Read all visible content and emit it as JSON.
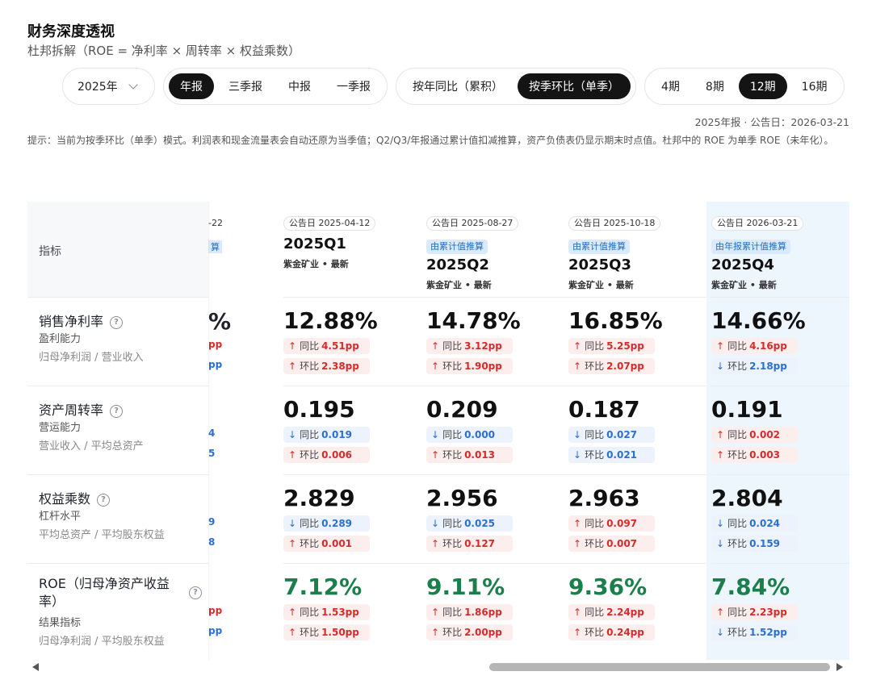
{
  "header": {
    "title": "财务深度透视",
    "subtitle": "杜邦拆解（ROE = 净利率 × 周转率 × 权益乘数）"
  },
  "toolbar": {
    "year": "2025年",
    "report_types": [
      "年报",
      "三季报",
      "中报",
      "一季报"
    ],
    "report_active": "年报",
    "compare_modes": [
      "按年同比（累积）",
      "按季环比（单季）"
    ],
    "compare_active": "按季环比（单季）",
    "periods": [
      "4期",
      "8期",
      "12期",
      "16期"
    ],
    "period_active": "12期"
  },
  "meta": "2025年报 · 公告日：2026-03-21",
  "tip": "提示：当前为按季环比（单季）模式。利润表和现金流量表会自动还原为当季值；Q2/Q3/年报通过累计值扣减推算，资产负债表仍显示期末时点值。杜邦中的 ROE 为单季 ROE（未年化）。",
  "table": {
    "indicator_header": "指标",
    "rows": [
      {
        "name": "销售净利率",
        "category": "盈利能力",
        "formula": "归母净利润 / 营业收入"
      },
      {
        "name": "资产周转率",
        "category": "营运能力",
        "formula": "营业收入 / 平均总资产"
      },
      {
        "name": "权益乘数",
        "category": "杠杆水平",
        "formula": "平均总资产 / 平均股东权益"
      },
      {
        "name": "ROE（归母净资产收益率）",
        "category": "结果指标",
        "formula": "归母净利润 / 平均股东权益"
      }
    ],
    "partial_column": {
      "announce": "-22",
      "est": "算",
      "values": [
        "%",
        "",
        "",
        ""
      ],
      "yoy": [
        "pp",
        "4",
        "9",
        "pp"
      ],
      "qoq": [
        "pp",
        "5",
        "8",
        "pp"
      ],
      "yoy_dir": [
        "up",
        "down",
        "down",
        "up"
      ],
      "qoq_dir": [
        "down",
        "down",
        "down",
        "down"
      ]
    },
    "columns": [
      {
        "announce": "公告日 2025-04-12",
        "estimate": "",
        "quarter": "2025Q1",
        "company": "紫金矿业 • 最新",
        "cells": [
          {
            "value": "12.88%",
            "yoy": "4.51pp",
            "yoy_dir": "up",
            "qoq": "2.38pp",
            "qoq_dir": "up"
          },
          {
            "value": "0.195",
            "yoy": "0.019",
            "yoy_dir": "down",
            "qoq": "0.006",
            "qoq_dir": "up"
          },
          {
            "value": "2.829",
            "yoy": "0.289",
            "yoy_dir": "down",
            "qoq": "0.001",
            "qoq_dir": "up"
          },
          {
            "value": "7.12%",
            "yoy": "1.53pp",
            "yoy_dir": "up",
            "qoq": "1.50pp",
            "qoq_dir": "up"
          }
        ]
      },
      {
        "announce": "公告日 2025-08-27",
        "estimate": "由累计值推算",
        "quarter": "2025Q2",
        "company": "紫金矿业 • 最新",
        "cells": [
          {
            "value": "14.78%",
            "yoy": "3.12pp",
            "yoy_dir": "up",
            "qoq": "1.90pp",
            "qoq_dir": "up"
          },
          {
            "value": "0.209",
            "yoy": "0.000",
            "yoy_dir": "down",
            "qoq": "0.013",
            "qoq_dir": "up"
          },
          {
            "value": "2.956",
            "yoy": "0.025",
            "yoy_dir": "down",
            "qoq": "0.127",
            "qoq_dir": "up"
          },
          {
            "value": "9.11%",
            "yoy": "1.86pp",
            "yoy_dir": "up",
            "qoq": "2.00pp",
            "qoq_dir": "up"
          }
        ]
      },
      {
        "announce": "公告日 2025-10-18",
        "estimate": "由累计值推算",
        "quarter": "2025Q3",
        "company": "紫金矿业 • 最新",
        "cells": [
          {
            "value": "16.85%",
            "yoy": "5.25pp",
            "yoy_dir": "up",
            "qoq": "2.07pp",
            "qoq_dir": "up"
          },
          {
            "value": "0.187",
            "yoy": "0.027",
            "yoy_dir": "down",
            "qoq": "0.021",
            "qoq_dir": "down"
          },
          {
            "value": "2.963",
            "yoy": "0.097",
            "yoy_dir": "up",
            "qoq": "0.007",
            "qoq_dir": "up"
          },
          {
            "value": "9.36%",
            "yoy": "2.24pp",
            "yoy_dir": "up",
            "qoq": "0.24pp",
            "qoq_dir": "up"
          }
        ]
      },
      {
        "announce": "公告日 2026-03-21",
        "estimate": "由年报累计值推算",
        "quarter": "2025Q4",
        "company": "紫金矿业 • 最新",
        "cells": [
          {
            "value": "14.66%",
            "yoy": "4.16pp",
            "yoy_dir": "up",
            "qoq": "2.18pp",
            "qoq_dir": "down"
          },
          {
            "value": "0.191",
            "yoy": "0.002",
            "yoy_dir": "up",
            "qoq": "0.003",
            "qoq_dir": "up"
          },
          {
            "value": "2.804",
            "yoy": "0.024",
            "yoy_dir": "down",
            "qoq": "0.159",
            "qoq_dir": "down"
          },
          {
            "value": "7.84%",
            "yoy": "2.23pp",
            "yoy_dir": "up",
            "qoq": "1.52pp",
            "qoq_dir": "down"
          }
        ]
      }
    ],
    "labels": {
      "yoy": "同比",
      "qoq": "环比"
    },
    "highlight_column": "2025Q4"
  },
  "colors": {
    "up": "#d62b2b",
    "down": "#2a6fd1",
    "roe": "#1b7f4c",
    "active": "#141414",
    "highlight_bg": "#eef6fd"
  }
}
